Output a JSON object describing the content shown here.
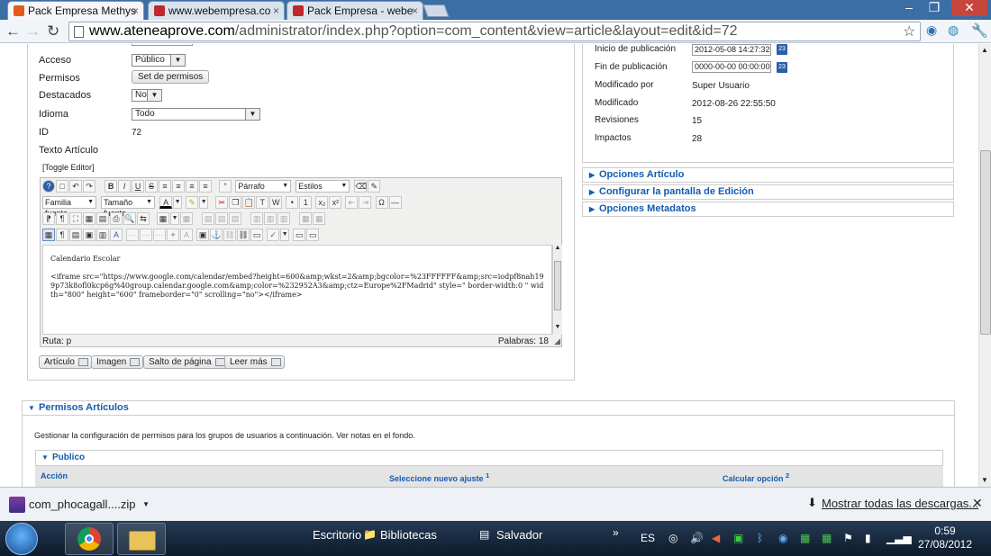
{
  "tabs": [
    {
      "label": "Pack Empresa Methys",
      "active": true
    },
    {
      "label": "www.webempresa.co",
      "active": false
    },
    {
      "label": "Pack Empresa - webe",
      "active": false
    }
  ],
  "url": {
    "host": "www.ateneaprove.com",
    "path": "/administrator/index.php?option=com_content&view=article&layout=edit&id=72"
  },
  "left_form": {
    "acceso_label": "Acceso",
    "acceso_value": "Público",
    "permisos_label": "Permisos",
    "permisos_button": "Set de permisos",
    "destacados_label": "Destacados",
    "destacados_value": "No",
    "idioma_label": "Idioma",
    "idioma_value": "Todo",
    "id_label": "ID",
    "id_value": "72",
    "texto_label": "Texto Artículo",
    "toggle_editor": "[Toggle Editor]"
  },
  "editor": {
    "format_select": "Párrafo",
    "styles_select": "Estilos",
    "font_family_select": "Familia fuente",
    "font_size_select": "Tamaño fuente",
    "content_line1": "Calendario Escolar",
    "content_line2": "<iframe src=\"https://www.google.com/calendar/embed?height=600&amp;wkst=2&amp;bgcolor=%23FFFFFF&amp;src=iodpf8nah199p73k8ofl0kcp6g%40group.calendar.google.com&amp;color=%232952A3&amp;ctz=Europe%2FMadrid\" style=\" border-width:0 \" width=\"800\" height=\"600\" frameborder=\"0\" scrolling=\"no\"></iframe>",
    "path": "Ruta: p",
    "word_count": "Palabras: 18"
  },
  "editor_buttons": [
    "Artículo",
    "Imagen",
    "Salto de página",
    "Leer más"
  ],
  "publishing": {
    "inicio_label": "Inicio de publicación",
    "inicio_value": "2012-05-08 14:27:32",
    "fin_label": "Fin de publicación",
    "fin_value": "0000-00-00 00:00:00",
    "modificado_por_label": "Modificado por",
    "modificado_por_value": "Super Usuario",
    "modificado_label": "Modificado",
    "modificado_value": "2012-08-26 22:55:50",
    "revisiones_label": "Revisiones",
    "revisiones_value": "15",
    "impactos_label": "Impactos",
    "impactos_value": "28"
  },
  "panels": [
    "Opciones Artículo",
    "Configurar la pantalla de Edición",
    "Opciones Metadatos"
  ],
  "permissions": {
    "title": "Permisos Artículos",
    "description": "Gestionar la configuración de permisos para los grupos de usuarios a continuación. Ver notas en el fondo.",
    "group": "Publico",
    "col_action": "Acción",
    "col_new_setting": "Seleccione nuevo ajuste",
    "col_new_sup": "1",
    "col_calc": "Calcular opción",
    "col_calc_sup": "2"
  },
  "downloads": {
    "file": "com_phocagall....zip",
    "show_all": "Mostrar todas las descargas..."
  },
  "taskbar": {
    "items": [
      "Escritorio",
      "Bibliotecas",
      "Salvador"
    ],
    "lang": "ES",
    "time": "0:59",
    "date": "27/08/2012"
  }
}
